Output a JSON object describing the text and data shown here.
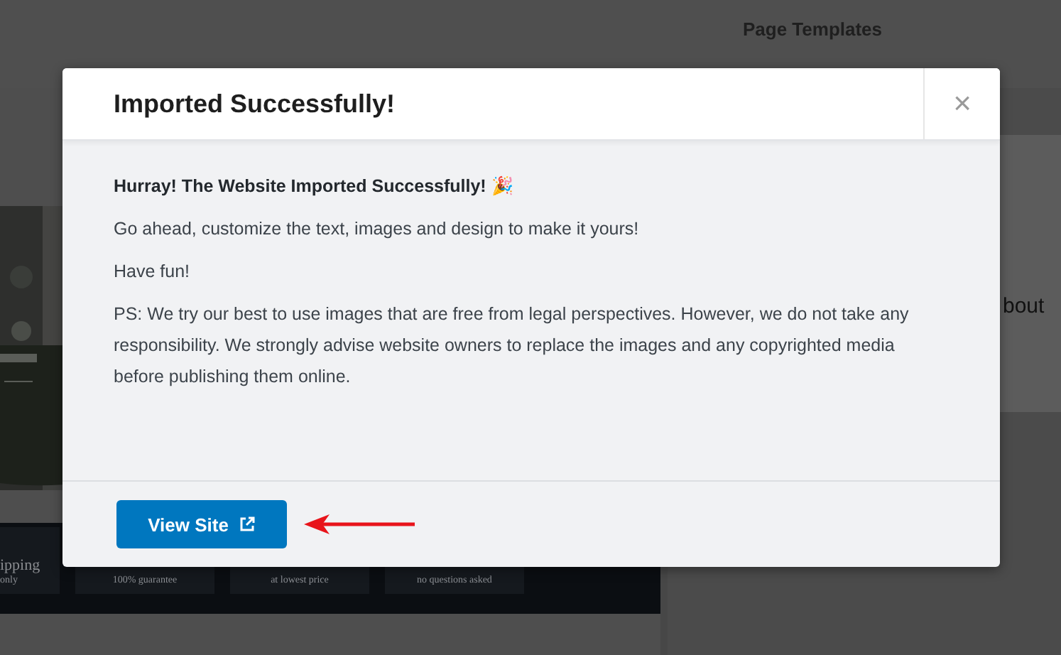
{
  "background": {
    "header_title": "Page Templates",
    "preview": {
      "kind": "picture",
      "features": [
        {
          "title": "ipping",
          "caption": "only"
        },
        {
          "caption": "100% guarantee"
        },
        {
          "caption": "at lowest price"
        },
        {
          "caption": "no questions asked"
        }
      ]
    },
    "side_card_heading": "bout"
  },
  "dialog": {
    "title": "Imported Successfully!",
    "close": "×",
    "paragraphs": [
      {
        "kind": "lead",
        "text": "Hurray! The Website Imported Successfully! 🎉"
      },
      {
        "kind": "plain",
        "text": "Go ahead, customize the text, images and design to make it yours!"
      },
      {
        "kind": "plain",
        "text": "Have fun!"
      },
      {
        "kind": "plain",
        "text": "PS: We try our best to use images that are free from legal perspectives. However, we do not take any responsibility. We strongly advise website owners to replace the images and any copyrighted media before publishing them online."
      }
    ],
    "button": "View Site"
  }
}
